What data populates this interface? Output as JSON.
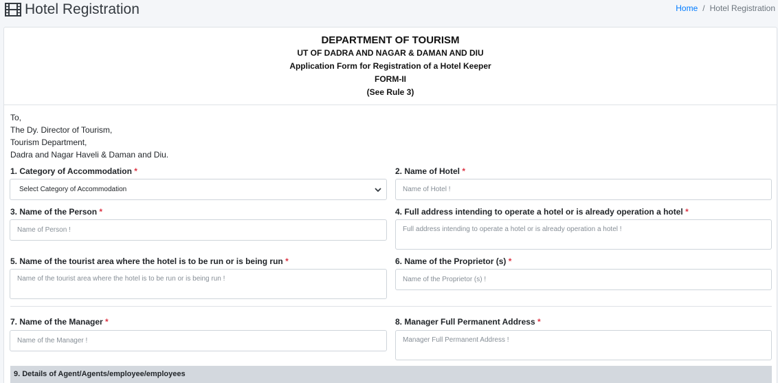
{
  "page": {
    "title": "Hotel Registration",
    "breadcrumb": {
      "home": "Home",
      "separator": "/",
      "current": "Hotel Registration"
    }
  },
  "form_header": {
    "line1": "DEPARTMENT OF TOURISM",
    "line2": "UT OF DADRA AND NAGAR & DAMAN AND DIU",
    "line3": "Application Form for Registration of a Hotel Keeper",
    "line4": "FORM-II",
    "line5": "(See Rule 3)"
  },
  "address": {
    "line1": "To,",
    "line2": "The Dy. Director of Tourism,",
    "line3": "Tourism Department,",
    "line4": "Dadra and Nagar Haveli & Daman and Diu."
  },
  "fields": {
    "category": {
      "label": "1. Category of Accommodation",
      "selected": "Select Category of Accommodation"
    },
    "hotel_name": {
      "label": "2. Name of Hotel",
      "placeholder": "Name of Hotel !"
    },
    "person_name": {
      "label": "3. Name of the Person",
      "placeholder": "Name of Person !"
    },
    "full_address": {
      "label": "4. Full address intending to operate a hotel or is already operation a hotel",
      "placeholder": "Full address intending to operate a hotel or is already operation a hotel !"
    },
    "tourist_area": {
      "label": "5. Name of the tourist area where the hotel is to be run or is being run",
      "placeholder": "Name of the tourist area where the hotel is to be run or is being run !"
    },
    "proprietor": {
      "label": "6. Name of the Proprietor (s)",
      "placeholder": "Name of the Proprietor (s) !"
    },
    "manager": {
      "label": "7. Name of the Manager",
      "placeholder": "Name of the Manager !"
    },
    "manager_address": {
      "label": "8. Manager Full Permanent Address",
      "placeholder": "Manager Full Permanent Address !"
    }
  },
  "required_marker": "*",
  "section": {
    "title": "9. Details of Agent/Agents/employee/employees"
  },
  "colors": {
    "link": "#007bff",
    "required": "#dc3545",
    "section_bg": "#d3d8de"
  }
}
